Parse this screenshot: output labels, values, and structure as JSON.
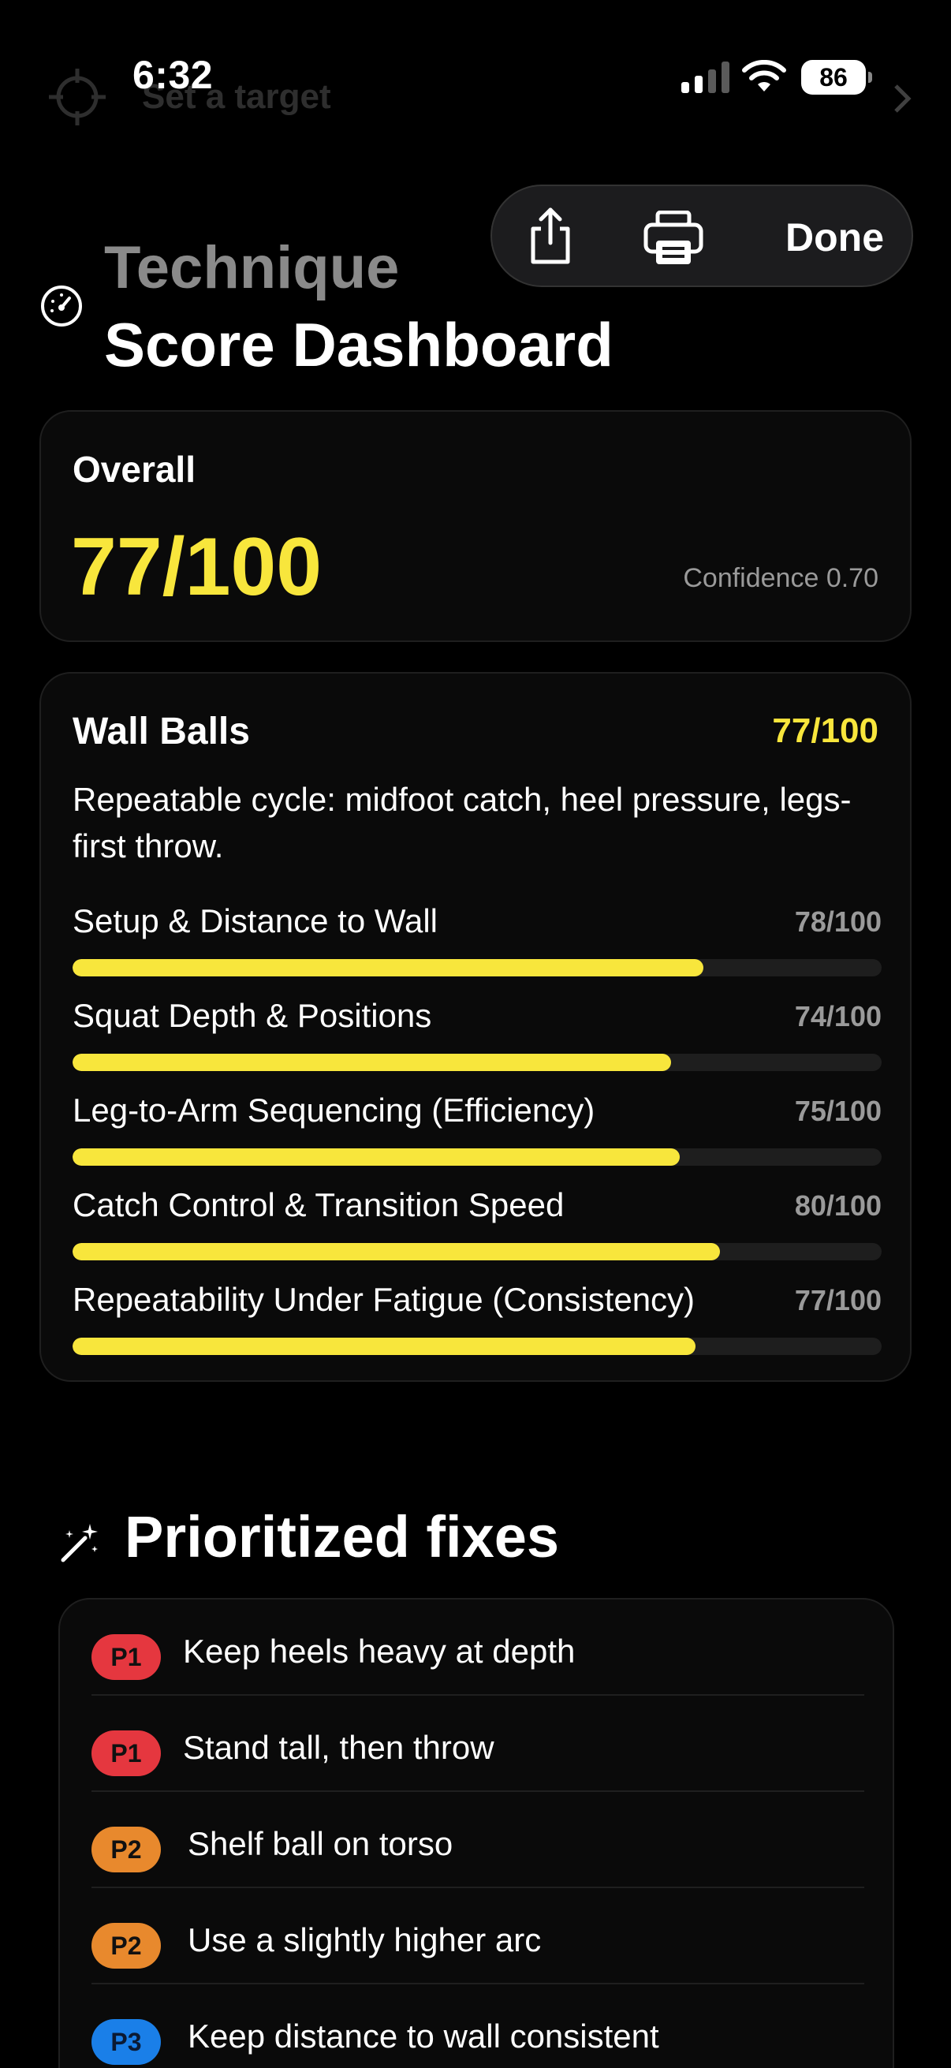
{
  "status_bar": {
    "time": "6:32",
    "battery": "86",
    "ghost_target_label": "Set a target"
  },
  "toolbar": {
    "done_label": "Done"
  },
  "header": {
    "title_line1": "Technique",
    "title_line2": "Score Dashboard"
  },
  "overall": {
    "label": "Overall",
    "score": "77/100",
    "confidence": "Confidence 0.70"
  },
  "wall_balls": {
    "title": "Wall Balls",
    "score": "77/100",
    "description": "Repeatable cycle: midfoot catch, heel pressure, legs-first throw.",
    "metrics": [
      {
        "label": "Setup & Distance to Wall",
        "score": "78/100",
        "value": 78
      },
      {
        "label": "Squat Depth & Positions",
        "score": "74/100",
        "value": 74
      },
      {
        "label": "Leg-to-Arm Sequencing (Efficiency)",
        "score": "75/100",
        "value": 75
      },
      {
        "label": "Catch Control & Transition Speed",
        "score": "80/100",
        "value": 80
      },
      {
        "label": "Repeatability Under Fatigue (Consistency)",
        "score": "77/100",
        "value": 77
      }
    ]
  },
  "fixes": {
    "title": "Prioritized fixes",
    "items": [
      {
        "priority": "P1",
        "text": "Keep heels heavy at depth"
      },
      {
        "priority": "P1",
        "text": "Stand tall, then throw"
      },
      {
        "priority": "P2",
        "text": "Shelf ball on torso"
      },
      {
        "priority": "P2",
        "text": "Use a slightly higher arc"
      },
      {
        "priority": "P3",
        "text": "Keep distance to wall consistent"
      }
    ]
  },
  "colors": {
    "accent": "#f8e63c",
    "p1": "#e5373f",
    "p2": "#e8892d",
    "p3": "#1a7fe8"
  }
}
